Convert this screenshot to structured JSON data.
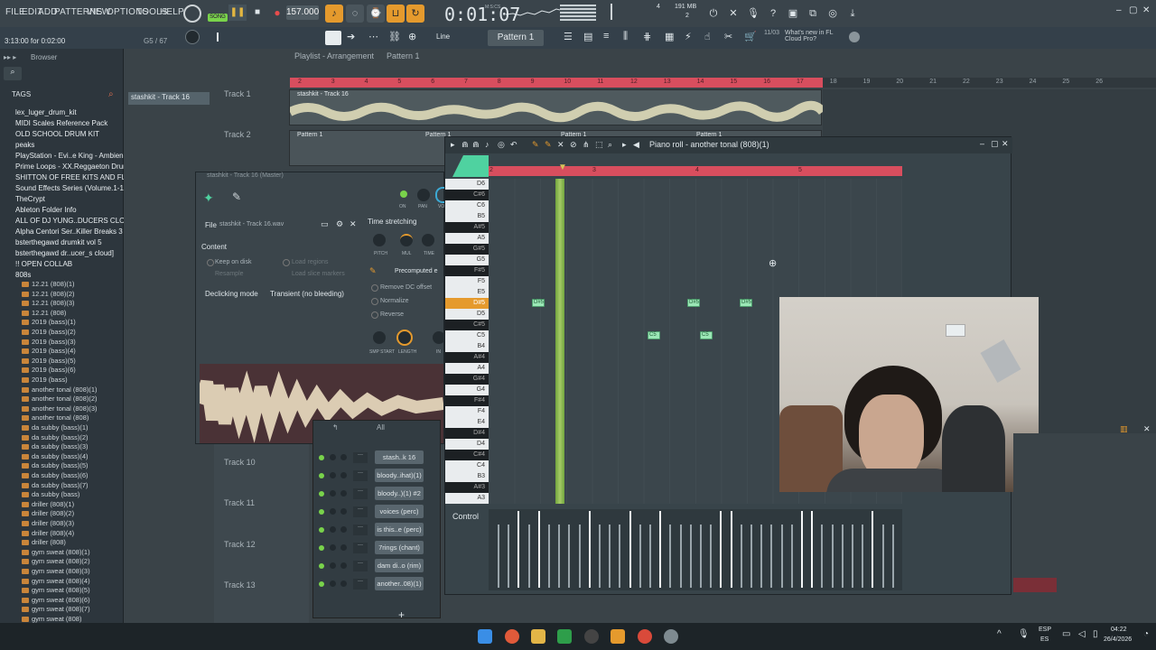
{
  "menu": {
    "items": [
      "FILE",
      "EDIT",
      "ADD",
      "PATTERNS",
      "VIEW",
      "OPTIONS",
      "TOOLS",
      "HELP"
    ]
  },
  "transport": {
    "song_label": "SONG",
    "tempo": "157.000",
    "time": "0:01:07",
    "time_unit": "M:S:CS",
    "mem": "191 MB",
    "cpu": "2",
    "voices": "4"
  },
  "hint": {
    "text": "3:13:00 for 0:02:00",
    "g5": "G5 / 67"
  },
  "toolbar2": {
    "snap": "Line",
    "pattern": "Pattern 1",
    "news_date": "11/03",
    "news_text": "What's new in FL Cloud Pro?"
  },
  "browser": {
    "title": "Browser",
    "tags_label": "TAGS",
    "folders": [
      "lex_luger_drum_kit",
      "MIDI Scales Reference Pack",
      "OLD SCHOOL DRUM KIT",
      "peaks",
      "PlayStation - Evi..e King - Ambience",
      "Prime Loops - XX.Reggaeton Drums",
      "SHITTON OF FREE KITS AND FLPS",
      "Sound Effects Series (Volume.1-10)",
      "TheCrypt",
      "Ableton Folder Info",
      "ALL OF DJ YUNG..DUCERS CLOUD]",
      "Alpha Centori Ser..Killer Breaks 3",
      "bsterthegawd drumkit vol 5",
      "bsterthegawd dr..ucer_s cloud]",
      "!! OPEN COLLAB",
      "808s"
    ],
    "files": [
      "12.21 (808)(1)",
      "12.21 (808)(2)",
      "12.21 (808)(3)",
      "12.21 (808)",
      "2019 (bass)(1)",
      "2019 (bass)(2)",
      "2019 (bass)(3)",
      "2019 (bass)(4)",
      "2019 (bass)(5)",
      "2019 (bass)(6)",
      "2019 (bass)",
      "another tonal (808)(1)",
      "another tonal (808)(2)",
      "another tonal (808)(3)",
      "another tonal (808)",
      "da subby (bass)(1)",
      "da subby (bass)(2)",
      "da subby (bass)(3)",
      "da subby (bass)(4)",
      "da subby (bass)(5)",
      "da subby (bass)(6)",
      "da subby (bass)(7)",
      "da subby (bass)",
      "driller (808)(1)",
      "driller (808)(2)",
      "driller (808)(3)",
      "driller (808)(4)",
      "driller (808)",
      "gym sweat (808)(1)",
      "gym sweat (808)(2)",
      "gym sweat (808)(3)",
      "gym sweat (808)(4)",
      "gym sweat (808)(5)",
      "gym sweat (808)(6)",
      "gym sweat (808)(7)",
      "gym sweat (808)"
    ]
  },
  "playlist": {
    "title": "Playlist - Arrangement",
    "pattern": "Pattern 1",
    "selected_track": "stashkit - Track 16",
    "clip_track1": "stashkit - Track 16",
    "tracks": [
      "Track 1",
      "Track 2",
      "Track 10",
      "Track 11",
      "Track 12",
      "Track 13"
    ],
    "pattern_clips": [
      "Pattern 1",
      "Pattern 1",
      "Pattern 1",
      "Pattern 1"
    ],
    "bar_numbers": [
      "2",
      "3",
      "4",
      "5",
      "6",
      "7",
      "8",
      "9",
      "10",
      "11",
      "12",
      "13",
      "14",
      "15",
      "16",
      "17",
      "18",
      "19",
      "20",
      "21",
      "22",
      "23",
      "24",
      "25",
      "26"
    ]
  },
  "sampler": {
    "title": "stashkit - Track 16 (Master)",
    "file_label": "File",
    "file_name": "stashkit - Track 16.wav",
    "content_label": "Content",
    "keep_on_disk": "Keep on disk",
    "resample": "Resample",
    "load_regions": "Load regions",
    "load_slice": "Load slice markers",
    "declicking_label": "Declicking mode",
    "declicking_value": "Transient (no bleeding)",
    "time_stretching": "Time stretching",
    "knob_labels": [
      "PITCH",
      "MUL",
      "TIME"
    ],
    "precomputed": "Precomputed e",
    "remove_dc": "Remove DC offset",
    "normalize": "Normalize",
    "reverse": "Reverse",
    "knob_labels2": [
      "SMP START",
      "LENGTH",
      "IN"
    ],
    "mix_labels": [
      "ON",
      "PAN",
      "VO"
    ]
  },
  "pianoroll": {
    "title": "Piano roll - another tonal (808)(1)",
    "bar_labels": [
      "2",
      "3",
      "4",
      "5"
    ],
    "keys": [
      "D6",
      "C#6",
      "C6",
      "B5",
      "A#5",
      "A5",
      "G#5",
      "G5",
      "F#5",
      "F5",
      "E5",
      "D#5",
      "D5",
      "C#5",
      "C5",
      "B4",
      "A#4",
      "A4",
      "G#4",
      "G4",
      "F#4",
      "F4",
      "E4",
      "D#4",
      "D4",
      "C#4",
      "C4",
      "B3",
      "A#3",
      "A3"
    ],
    "notes": [
      {
        "label": "D#5",
        "row": "D#5"
      },
      {
        "label": "D#5",
        "row": "D#5"
      },
      {
        "label": "D#5",
        "row": "D#5"
      },
      {
        "label": "C5",
        "row": "C5"
      },
      {
        "label": "C5",
        "row": "C5"
      }
    ],
    "control_label": "Control"
  },
  "channelrack": {
    "filter": "All",
    "channels": [
      "stash..k 16",
      "bloody..ihat)(1)",
      "bloody..)(1) #2",
      "voices (perc)",
      "is this..e (perc)",
      "7rings (chant)",
      "dam di..o (rim)",
      "another..08)(1)"
    ]
  },
  "taskbar": {
    "lang": "ESP",
    "lang2": "ES",
    "clock": "04:22",
    "date": "26/4/2026"
  }
}
